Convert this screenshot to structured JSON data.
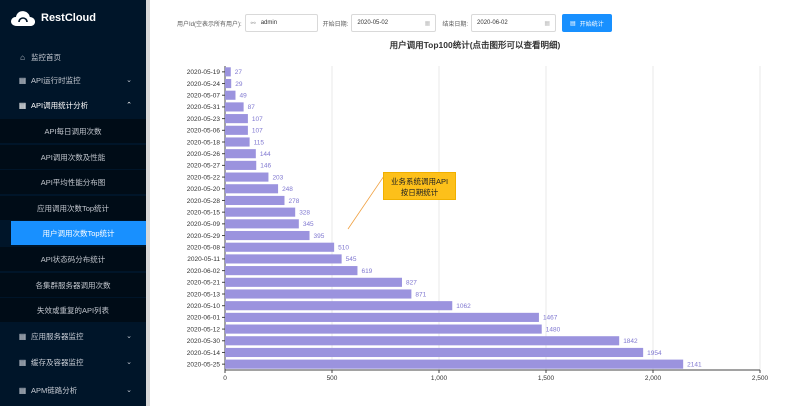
{
  "app": {
    "logo_text": "RestCloud"
  },
  "sidebar": {
    "items": [
      {
        "label": "监控首页",
        "icon": "home-icon"
      },
      {
        "label": "API运行时监控",
        "icon": "grid-icon",
        "caret": "⌄"
      },
      {
        "label": "API调用统计分析",
        "icon": "grid-icon",
        "caret": "⌃"
      },
      {
        "label": "API每日调用次数"
      },
      {
        "label": "API调用次数及性能"
      },
      {
        "label": "API平均性能分布图"
      },
      {
        "label": "应用调用次数Top统计"
      },
      {
        "label": "用户调用次数Top统计"
      },
      {
        "label": "API状态码分布统计"
      },
      {
        "label": "各集群服务器调用次数"
      },
      {
        "label": "失效或重复的API列表"
      },
      {
        "label": "应用服务器监控",
        "icon": "grid-icon",
        "caret": "⌄"
      },
      {
        "label": "缓存及容器监控",
        "icon": "grid-icon",
        "caret": "⌄"
      },
      {
        "label": "APM链路分析",
        "icon": "grid-icon",
        "caret": "⌄"
      }
    ]
  },
  "filters": {
    "user_label": "用户Id(空表示所有用户):",
    "user_value": "admin",
    "user_icon": "user-icon",
    "start_label": "开始日期:",
    "start_value": "2020-05-02",
    "end_label": "结束日期:",
    "end_value": "2020-06-02",
    "calendar_icon": "calendar-icon",
    "button_label": "开始统计",
    "button_icon": "bar-chart-icon"
  },
  "annotation": {
    "line1": "业务系统调用API",
    "line2": "按日期统计"
  },
  "colors": {
    "bar": "#9b93de",
    "label": "#7f77d0",
    "accent": "#1890ff",
    "annotation": "#fdc01a"
  },
  "chart_data": {
    "type": "bar",
    "orientation": "horizontal",
    "title": "用户调用Top100统计(点击图形可以查看明细)",
    "categories": [
      "2020-05-19",
      "2020-05-24",
      "2020-05-07",
      "2020-05-31",
      "2020-05-23",
      "2020-05-06",
      "2020-05-18",
      "2020-05-26",
      "2020-05-27",
      "2020-05-22",
      "2020-05-20",
      "2020-05-28",
      "2020-05-15",
      "2020-05-09",
      "2020-05-29",
      "2020-05-08",
      "2020-05-11",
      "2020-06-02",
      "2020-05-21",
      "2020-05-13",
      "2020-05-10",
      "2020-06-01",
      "2020-05-12",
      "2020-05-30",
      "2020-05-14",
      "2020-05-25"
    ],
    "values": [
      27,
      29,
      49,
      87,
      107,
      107,
      115,
      144,
      146,
      203,
      248,
      278,
      328,
      345,
      395,
      510,
      545,
      619,
      827,
      871,
      1062,
      1467,
      1480,
      1842,
      1954,
      2141
    ],
    "xlim": [
      0,
      2500
    ],
    "x_ticks": [
      0,
      500,
      1000,
      1500,
      2000,
      2500
    ],
    "x_tick_labels": [
      "0",
      "500",
      "1,000",
      "1,500",
      "2,000",
      "2,500"
    ],
    "grid": true,
    "data_labels": true
  }
}
